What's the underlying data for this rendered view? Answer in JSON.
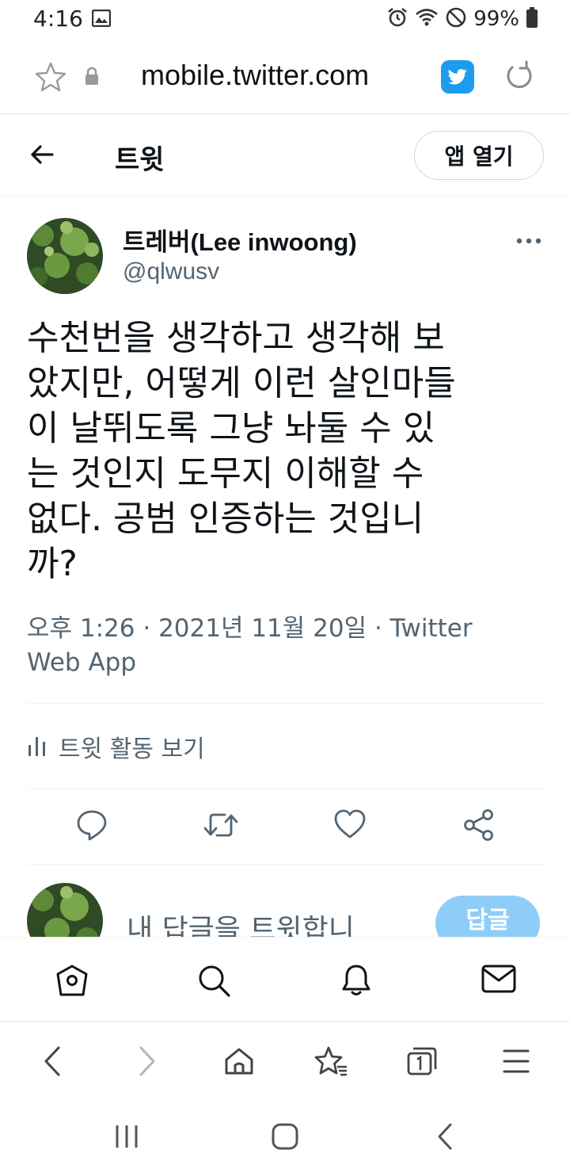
{
  "status_bar": {
    "time": "4:16",
    "battery": "99%"
  },
  "browser": {
    "url": "mobile.twitter.com"
  },
  "header": {
    "title": "트윗",
    "open_app_label": "앱 열기"
  },
  "tweet": {
    "display_name": "트레버(Lee inwoong)",
    "username": "@qlwusv",
    "text_lines": [
      "수천번을 생각하고 생각해 보",
      "았지만, 어떻게 이런 살인마들",
      "이 날뛰도록 그냥 놔둘 수 있",
      "는 것인지 도무지 이해할 수",
      "없다. 공범 인증하는 것입니",
      "까?"
    ],
    "meta_line1": "오후 1:26 · 2021년 11월 20일 · Twitter",
    "meta_line2": "Web App",
    "activity_label": "트윗 활동 보기"
  },
  "reply": {
    "placeholder": "내 답글을 트윗합니",
    "button_label": "답글"
  },
  "colors": {
    "twitter_blue": "#1d9bf0",
    "reply_button_disabled": "#8ecdf8",
    "secondary_text": "#536471"
  }
}
